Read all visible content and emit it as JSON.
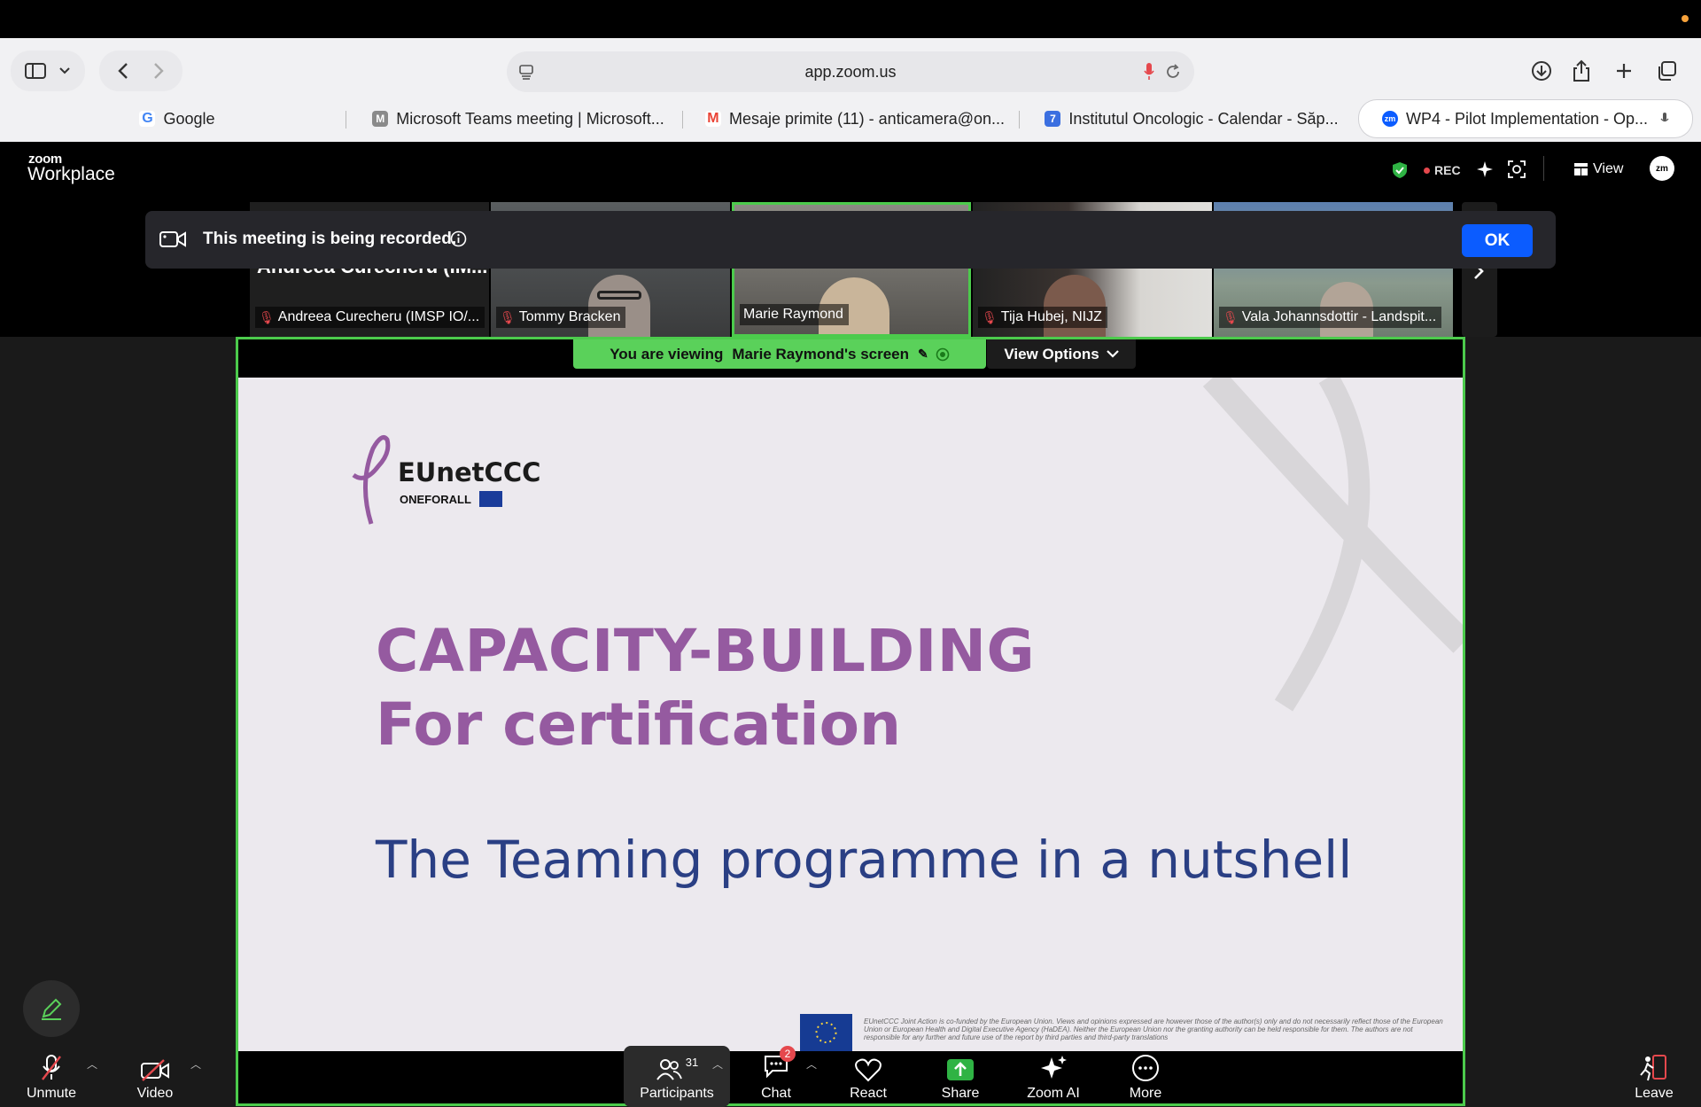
{
  "browser": {
    "url": "app.zoom.us",
    "tabs": [
      {
        "label": "Google",
        "favicon": "G",
        "color": "#4285f4"
      },
      {
        "label": "Microsoft Teams meeting | Microsoft...",
        "favicon": "M",
        "color": "#8a8a8a"
      },
      {
        "label": "Mesaje primite (11) - anticamera@on...",
        "favicon": "M",
        "color": "#ea4335"
      },
      {
        "label": "Institutul Oncologic - Calendar - Săp...",
        "favicon": "7",
        "color": "#3b6fe0"
      },
      {
        "label": "WP4 - Pilot Implementation - Op...",
        "favicon": "zm",
        "color": "#0b5cff"
      }
    ]
  },
  "zoom": {
    "brand_small": "zoom",
    "brand_big": "Workplace",
    "rec_label": "REC",
    "view_label": "View",
    "avatar_label": "zm"
  },
  "participants_strip": [
    {
      "name": "Andreea Curecheru (IMSP IO/...",
      "muted": true,
      "overlay_name": "Andreea Curecheru (IM..."
    },
    {
      "name": "Tommy Bracken",
      "muted": true
    },
    {
      "name": "Marie Raymond",
      "muted": false
    },
    {
      "name": "Tija Hubej, NIJZ",
      "muted": true
    },
    {
      "name": "Vala Johannsdottir - Landspit...",
      "muted": true
    }
  ],
  "banner": {
    "text": "This meeting is being recorded.",
    "ok_label": "OK"
  },
  "share": {
    "viewing_prefix": "You are viewing",
    "viewing_name": "Marie Raymond's screen",
    "view_options_label": "View Options"
  },
  "slide": {
    "logo_main": "EUnetCCC",
    "logo_sub": "ONEFORALL",
    "title_line1": "CAPACITY-BUILDING",
    "title_line2": "For certification",
    "subtitle": "The Teaming programme in a nutshell",
    "disclaimer": "EUnetCCC Joint Action is co-funded by the European Union. Views and opinions expressed are however those of the author(s) only and do not necessarily reflect those of the European Union or European Health and Digital Executive Agency (HaDEA). Neither the European Union nor the granting authority can be held responsible for them. The authors are not responsible for any further and future use of the report by third parties and third-party translations"
  },
  "toolbar": {
    "unmute": "Unmute",
    "video": "Video",
    "participants": "Participants",
    "participants_count": "31",
    "chat": "Chat",
    "chat_badge": "2",
    "react": "React",
    "share": "Share",
    "zoom_ai": "Zoom AI",
    "more": "More",
    "leave": "Leave"
  }
}
